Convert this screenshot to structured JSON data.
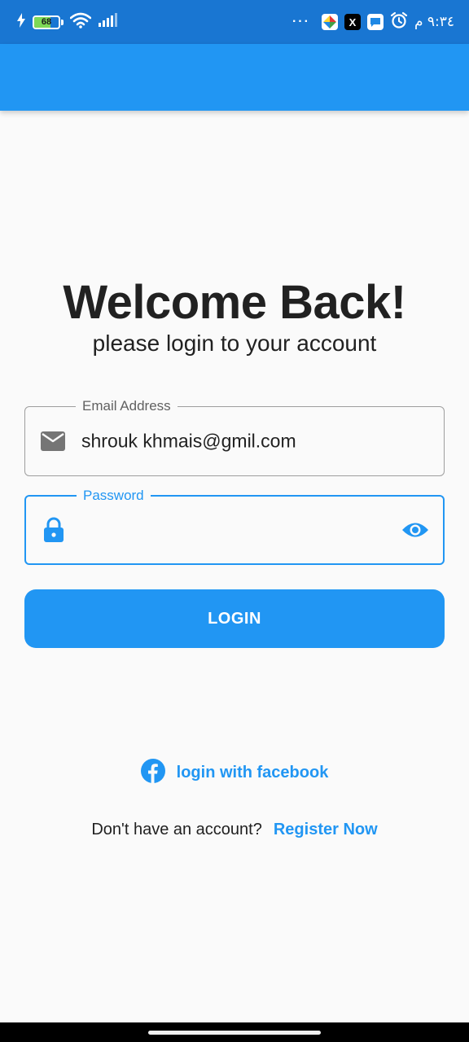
{
  "status_bar": {
    "battery_level": "68",
    "time": "٩:٣٤ م",
    "overflow": "···",
    "x_app_label": "X"
  },
  "login": {
    "title": "Welcome Back!",
    "subtitle": "please login to your account",
    "email": {
      "label": "Email Address",
      "value": "shrouk khmais@gmil.com",
      "icon": "mail-icon"
    },
    "password": {
      "label": "Password",
      "value": "",
      "icon": "lock-icon",
      "toggle_icon": "eye-icon"
    },
    "login_button": "LOGIN",
    "facebook_link": "login with facebook",
    "register_question": "Don't have an account?",
    "register_link": "Register Now"
  },
  "colors": {
    "primary": "#2196f3",
    "status_bar": "#1976d2",
    "background": "#fafafa"
  }
}
